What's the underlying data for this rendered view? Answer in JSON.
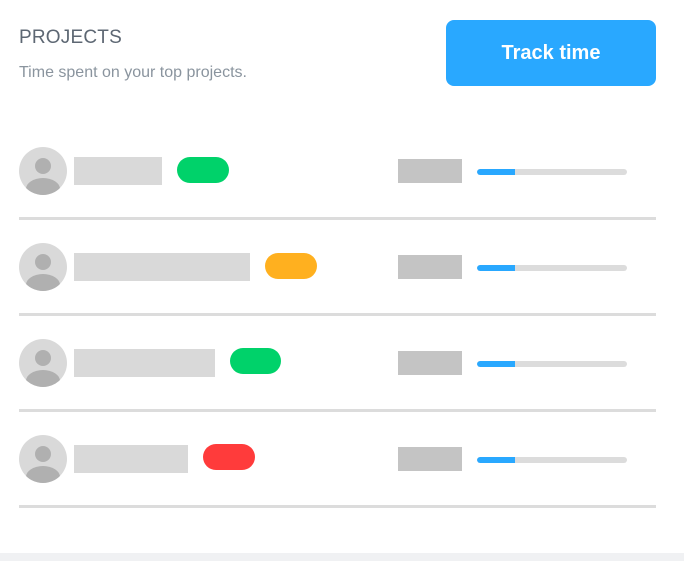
{
  "header": {
    "title": "PROJECTS",
    "subtitle": "Time spent on your top projects.",
    "track_button_label": "Track time"
  },
  "colors": {
    "accent": "#29a8ff",
    "tag_green": "#00d26a",
    "tag_orange": "#ffb01f",
    "tag_red": "#ff3b3b",
    "placeholder": "#d9d9d9"
  },
  "projects": [
    {
      "avatar_icon": "user-avatar-icon",
      "tag_color": "#00d26a",
      "progress": 0.25
    },
    {
      "avatar_icon": "user-avatar-icon",
      "tag_color": "#ffb01f",
      "progress": 0.25
    },
    {
      "avatar_icon": "user-avatar-icon",
      "tag_color": "#00d26a",
      "progress": 0.25
    },
    {
      "avatar_icon": "user-avatar-icon",
      "tag_color": "#ff3b3b",
      "progress": 0.25
    }
  ]
}
